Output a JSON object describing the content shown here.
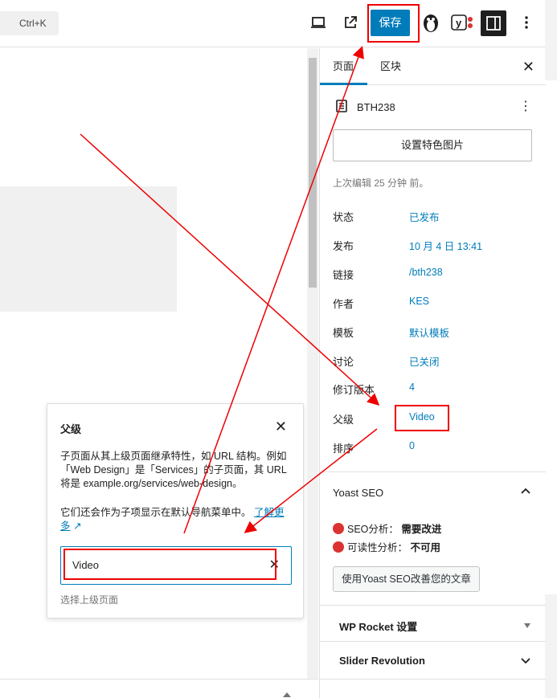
{
  "topbar": {
    "shortcut_label": "Ctrl+K",
    "save_label": "保存",
    "icons": [
      "desktop-preview-icon",
      "external-link-icon",
      "penguin-plugin-icon",
      "yoast-icon",
      "sidebar-toggle-icon",
      "more-options-icon"
    ]
  },
  "sidebar": {
    "tabs": [
      {
        "label": "页面"
      },
      {
        "label": "区块"
      }
    ],
    "close_icon": "close-icon",
    "doc_title": "BTH238",
    "featured_image_label": "设置特色图片",
    "last_edited": "上次编辑 25 分钟 前。",
    "meta": [
      {
        "label": "状态",
        "value": "已发布"
      },
      {
        "label": "发布",
        "value": "10 月 4 日 13:41"
      },
      {
        "label": "链接",
        "value": "/bth238"
      },
      {
        "label": "作者",
        "value": "KES"
      },
      {
        "label": "模板",
        "value": "默认模板"
      },
      {
        "label": "讨论",
        "value": "已关闭"
      },
      {
        "label": "修订版本",
        "value": "4"
      },
      {
        "label": "父级",
        "value": "Video"
      },
      {
        "label": "排序",
        "value": "0"
      }
    ],
    "yoast": {
      "title": "Yoast SEO",
      "seo_label": "SEO分析：",
      "seo_value": "需要改进",
      "read_label": "可读性分析：",
      "read_value": "不可用",
      "button": "使用Yoast SEO改善您的文章"
    },
    "wp_rocket": "WP Rocket 设置",
    "slider": "Slider Revolution"
  },
  "popover": {
    "title": "父级",
    "desc": "子页面从其上级页面继承特性，如 URL 结构。例如「Web Design」是「Services」的子页面，其 URL 将是 example.org/services/web-design。",
    "desc2": "它们还会作为子项显示在默认导航菜单中。",
    "learn_more": "了解更多",
    "input_value": "Video",
    "hint": "选择上级页面"
  },
  "colors": {
    "accent": "#007cba",
    "annotation": "#e00000",
    "error": "#dc3232"
  }
}
